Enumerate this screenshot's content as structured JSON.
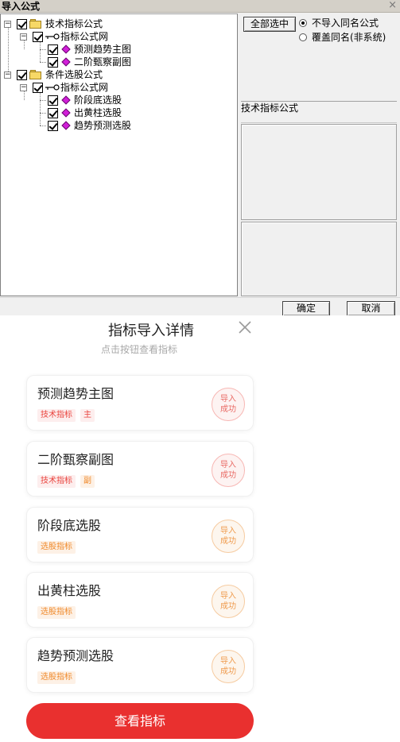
{
  "dialog": {
    "title": "导入公式",
    "close_glyph": "×",
    "tree": {
      "group1": {
        "label": "技术指标公式",
        "child": {
          "label": "指标公式网",
          "items": [
            "预测趋势主图",
            "二阶甄察副图"
          ]
        }
      },
      "group2": {
        "label": "条件选股公式",
        "child": {
          "label": "指标公式网",
          "items": [
            "阶段底选股",
            "出黄柱选股",
            "趋势预测选股"
          ]
        }
      }
    },
    "select_all_label": "全部选中",
    "radio_options": [
      "不导入同名公式",
      "覆盖同名(非系统)"
    ],
    "radio_selected_index": 0,
    "formula_type_label": "技术指标公式",
    "ok_label": "确定",
    "cancel_label": "取消"
  },
  "sheet": {
    "title": "指标导入详情",
    "subtitle": "点击按钮查看指标",
    "cards": [
      {
        "name": "预测趋势主图",
        "tags": [
          "技术指标",
          "主"
        ],
        "status": [
          "导入",
          "成功"
        ],
        "tone": "red"
      },
      {
        "name": "二阶甄察副图",
        "tags": [
          "技术指标",
          "副"
        ],
        "status": [
          "导入",
          "成功"
        ],
        "tone": "red"
      },
      {
        "name": "阶段底选股",
        "tags": [
          "选股指标"
        ],
        "status": [
          "导入",
          "成功"
        ],
        "tone": "orange"
      },
      {
        "name": "出黄柱选股",
        "tags": [
          "选股指标"
        ],
        "status": [
          "导入",
          "成功"
        ],
        "tone": "orange"
      },
      {
        "name": "趋势预测选股",
        "tags": [
          "选股指标"
        ],
        "status": [
          "导入",
          "成功"
        ],
        "tone": "orange"
      }
    ],
    "view_button_label": "查看指标"
  },
  "colors": {
    "brand_red": "#e9302f",
    "tag_red": "#e9433d",
    "tag_orange": "#f08a2c",
    "folder_yellow": "#f7d866",
    "item_diamond": "#d11fd8"
  },
  "icons": {
    "dialog_close": "close-icon",
    "folder": "folder-icon",
    "formula_set": "key-icon",
    "formula_item": "diamond-icon",
    "sheet_close": "close-icon"
  }
}
